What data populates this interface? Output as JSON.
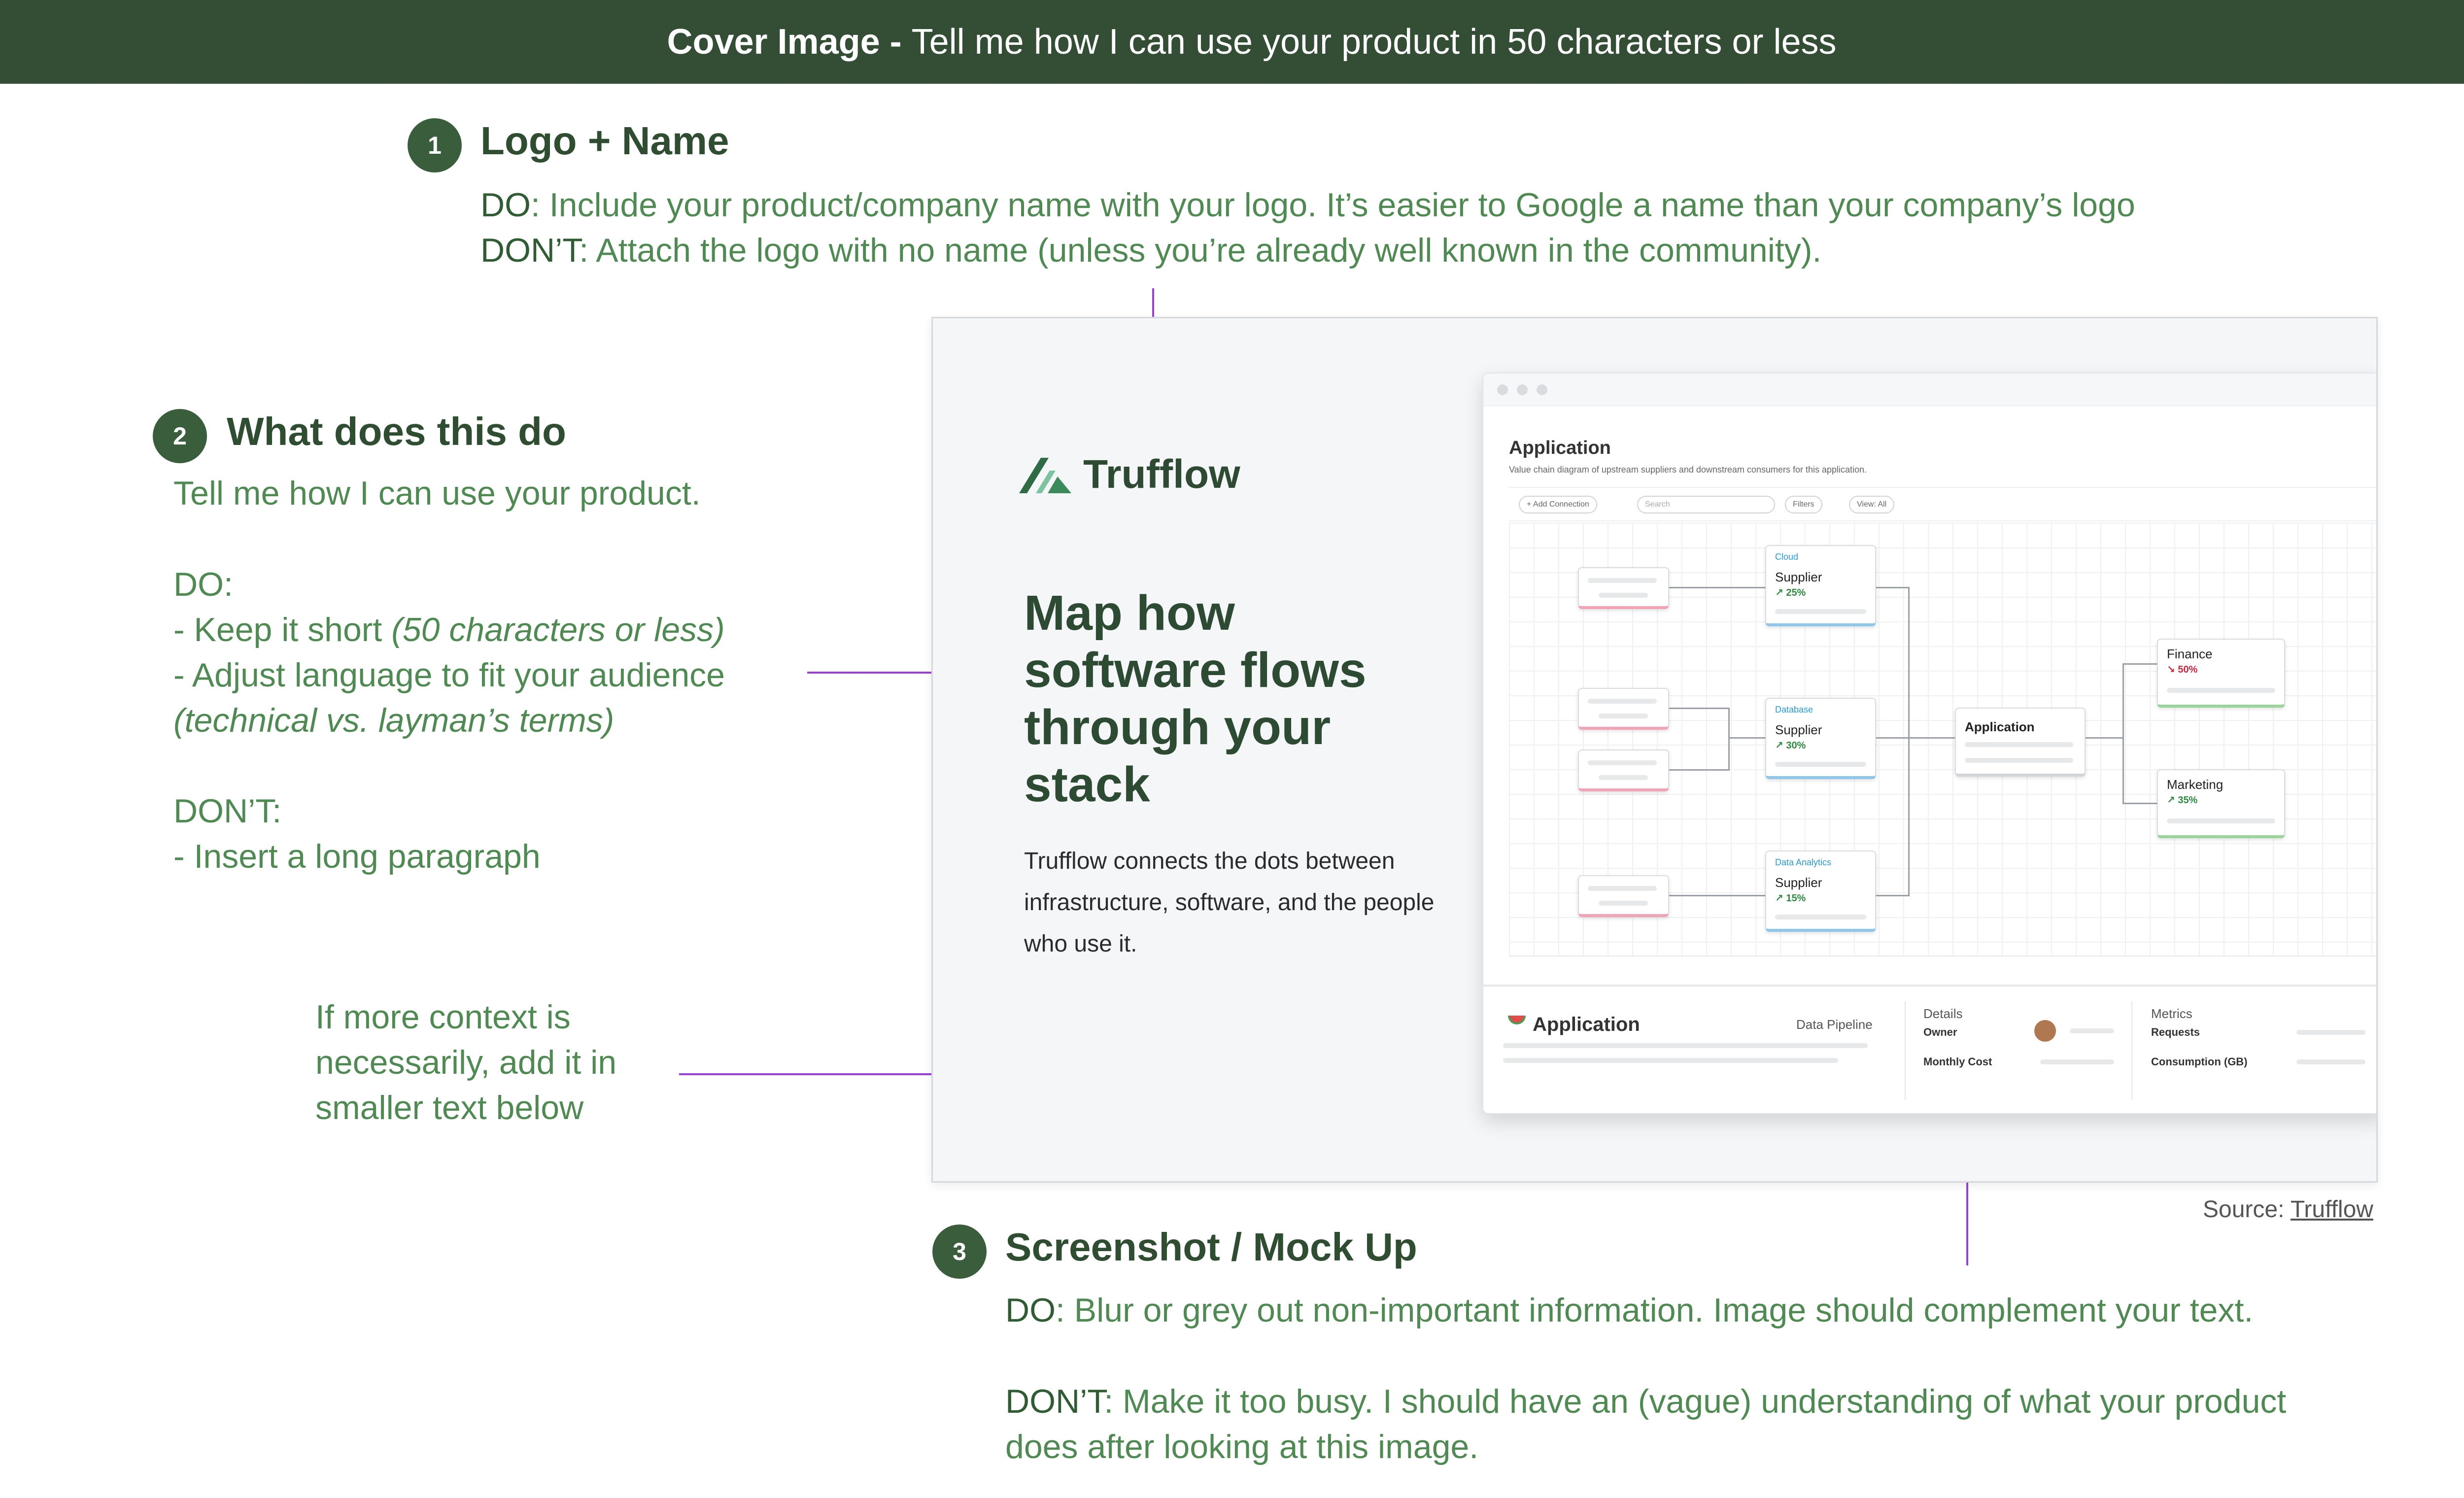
{
  "banner": {
    "bold": "Cover Image -",
    "rest": "Tell me how I can use your product in 50 characters or less"
  },
  "section1": {
    "number": "1",
    "heading": "Logo + Name",
    "do_key": "DO",
    "do_text": ": Include your product/company name with your logo. It’s easier to Google a name than your company’s logo",
    "dont_key": "DON’T",
    "dont_text": ": Attach the logo with no name (unless you’re already well known in the community)."
  },
  "section2": {
    "number": "2",
    "heading": "What does this do",
    "intro": "Tell me how I can use your product.",
    "do_label": "DO:",
    "do_item1": "- Keep it short ",
    "do_item1_note": "(50 characters or less)",
    "do_item2": "- Adjust language to fit your audience",
    "do_item2_note": "(technical vs. layman’s terms)",
    "dont_label": "DON’T:",
    "dont_item1": "- Insert a long paragraph",
    "context_line1": "If more context is",
    "context_line2": "necessarily, add it in",
    "context_line3": "smaller text below"
  },
  "section3": {
    "number": "3",
    "heading": "Screenshot / Mock Up",
    "do_key": "DO",
    "do_text": ": Blur or grey out non-important information. Image should complement your text.",
    "dont_key": "DON’T",
    "dont_text_line1": ": Make it too busy. I should have an (vague) understanding of what your product",
    "dont_text_line2": "does after looking at this image."
  },
  "mock": {
    "brand_name": "Trufflow",
    "hero_title": "Map how software flows through your stack",
    "hero_sub": "Trufflow connects the dots between infrastructure, software, and the people who use it.",
    "app": {
      "title": "Application",
      "subtitle": "Value chain diagram of upstream suppliers and downstream consumers for this application.",
      "toolbar": {
        "add_connection": "+ Add Connection",
        "search_placeholder": "Search",
        "filters": "Filters",
        "view": "View: All"
      },
      "suppliers": [
        {
          "tag": "Cloud",
          "label": "Supplier",
          "pct": "↗ 25%"
        },
        {
          "tag": "Database",
          "label": "Supplier",
          "pct": "↗ 30%"
        },
        {
          "tag": "Data Analytics",
          "label": "Supplier",
          "pct": "↗ 15%"
        }
      ],
      "center_node": "Application",
      "consumers": [
        {
          "label": "Finance",
          "pct": "↘ 50%"
        },
        {
          "label": "Marketing",
          "pct": "↗ 35%"
        }
      ],
      "details": {
        "title": "Application",
        "type": "Data Pipeline",
        "details_label": "Details",
        "owner": "Owner",
        "monthly_cost": "Monthly Cost",
        "metrics_label": "Metrics",
        "requests": "Requests",
        "consumption": "Consumption (GB)"
      }
    }
  },
  "source": {
    "prefix": "Source: ",
    "link": "Trufflow"
  },
  "colors": {
    "banner_bg": "#334e35",
    "heading": "#2f4e31",
    "body_text": "#4f8a52",
    "connector": "#9b3fd8"
  }
}
